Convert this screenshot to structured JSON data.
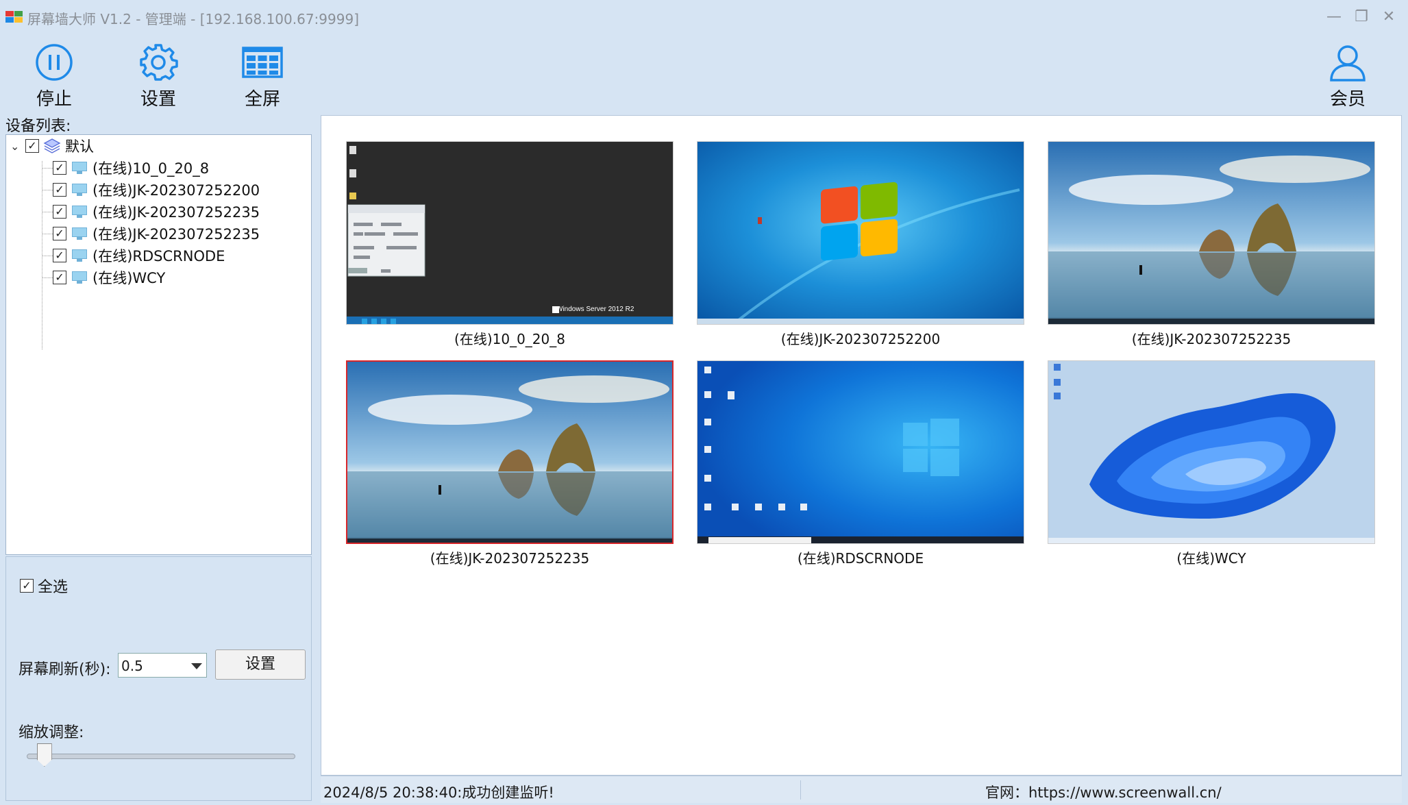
{
  "window": {
    "title": "屏幕墙大师 V1.2 - 管理端 - [192.168.100.67:9999]",
    "minimize": "—",
    "maximize": "❐",
    "close": "✕"
  },
  "toolbar": {
    "stop_label": "停止",
    "settings_label": "设置",
    "fullscreen_label": "全屏",
    "member_label": "会员",
    "accent": "#1f8ae8"
  },
  "sidebar": {
    "title": "设备列表:",
    "group": {
      "label": "默认",
      "checked": true
    },
    "devices": [
      {
        "label": "(在线)10_0_20_8",
        "checked": true
      },
      {
        "label": "(在线)JK-202307252200",
        "checked": true
      },
      {
        "label": "(在线)JK-202307252235",
        "checked": true
      },
      {
        "label": "(在线)JK-202307252235",
        "checked": true
      },
      {
        "label": "(在线)RDSCRNODE",
        "checked": true
      },
      {
        "label": "(在线)WCY",
        "checked": true
      }
    ],
    "select_all": {
      "label": "全选",
      "checked": true
    },
    "refresh": {
      "label": "屏幕刷新(秒):",
      "value": "0.5",
      "button": "设置"
    },
    "zoom": {
      "label": "缩放调整:",
      "level": 0.04
    }
  },
  "screens": [
    {
      "caption": "(在线)10_0_20_8",
      "wallpaper": "server-dark",
      "watermark": "Windows Server 2012 R2",
      "selected": false
    },
    {
      "caption": "(在线)JK-202307252200",
      "wallpaper": "win7-blue",
      "selected": false
    },
    {
      "caption": "(在线)JK-202307252235",
      "wallpaper": "win10-beach",
      "selected": false
    },
    {
      "caption": "(在线)JK-202307252235",
      "wallpaper": "win10-beach",
      "selected": true
    },
    {
      "caption": "(在线)RDSCRNODE",
      "wallpaper": "win10-hero",
      "selected": false
    },
    {
      "caption": "(在线)WCY",
      "wallpaper": "win11-bloom",
      "selected": false
    }
  ],
  "statusbar": {
    "message": "2024/8/5 20:38:40:成功创建监听!",
    "website": "官网：https://www.screenwall.cn/"
  }
}
